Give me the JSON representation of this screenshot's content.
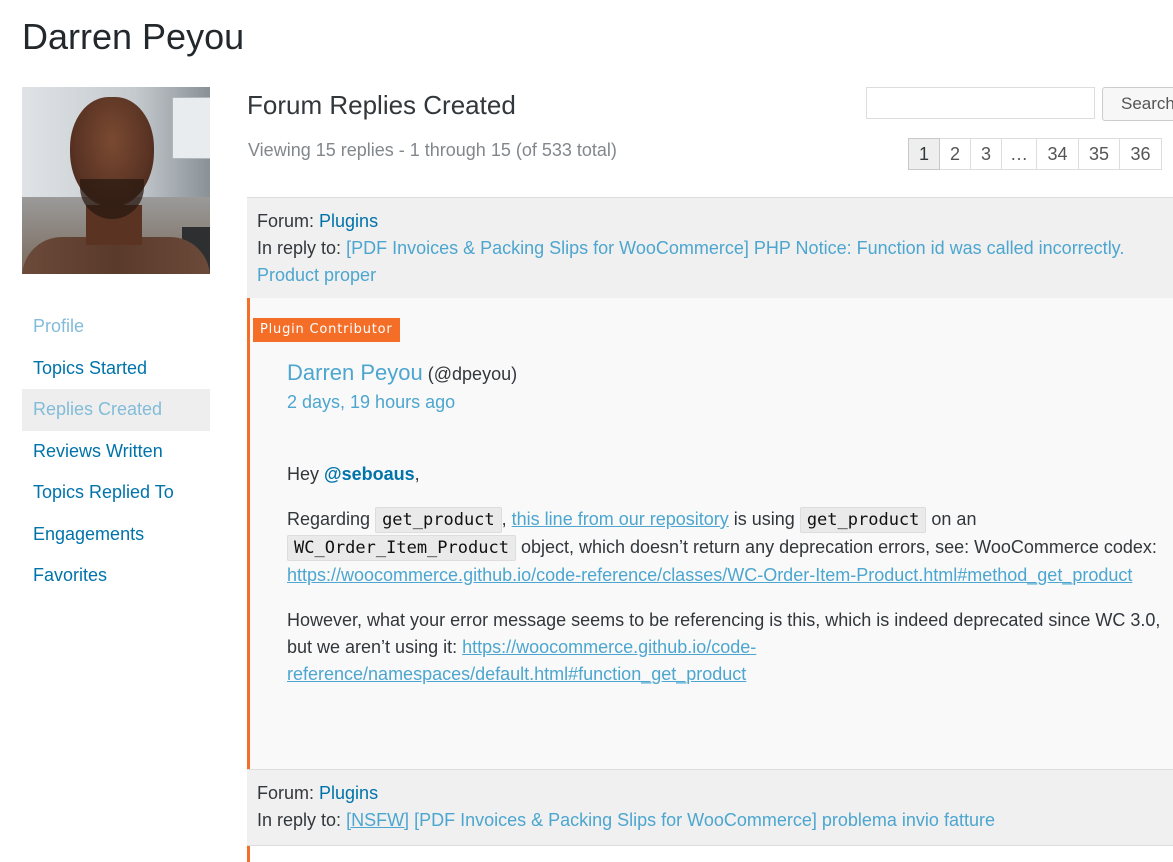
{
  "page": {
    "title": "Darren Peyou"
  },
  "sidebar": {
    "items": [
      {
        "label": "Profile"
      },
      {
        "label": "Topics Started"
      },
      {
        "label": "Replies Created"
      },
      {
        "label": "Reviews Written"
      },
      {
        "label": "Topics Replied To"
      },
      {
        "label": "Engagements"
      },
      {
        "label": "Favorites"
      }
    ],
    "active_item": "Replies Created"
  },
  "main": {
    "title": "Forum Replies Created",
    "count_text": "Viewing 15 replies - 1 through 15 (of 533 total)"
  },
  "search": {
    "value": "",
    "placeholder": "",
    "button_label": "Search"
  },
  "pagination": {
    "current": "1",
    "pages": [
      "1",
      "2",
      "3",
      "…",
      "34",
      "35",
      "36"
    ]
  },
  "replies": [
    {
      "forum_label": "Forum:",
      "forum_name": "Plugins",
      "reply_to_label": "In reply to:",
      "topic_title": "[PDF Invoices & Packing Slips for WooCommerce] PHP Notice: Function id was called incorrectly. Product proper",
      "badge": "Plugin Contributor",
      "author_name": "Darren Peyou",
      "author_handle": "(@dpeyou)",
      "timestamp": "2 days, 19 hours ago",
      "content": {
        "greeting": "Hey ",
        "mention": "@seboaus",
        "greeting_end": ",",
        "p2_t1": "Regarding ",
        "p2_code1": "get_product",
        "p2_t2": ", ",
        "p2_link1": "this line from our repository",
        "p2_t3": " is using ",
        "p2_code2": "get_product",
        "p2_t4": " on an ",
        "p2_code3": "WC_Order_Item_Product",
        "p2_t5": " object, which doesn’t return any deprecation errors, see: WooCommerce codex: ",
        "p2_link2": "https://woocommerce.github.io/code-reference/classes/WC-Order-Item-Product.html#method_get_product",
        "p3_t1": "However, what your error message seems to be referencing is this, which is indeed deprecated since WC 3.0, but we aren’t using it: ",
        "p3_link": "https://woocommerce.github.io/code-reference/namespaces/default.html#function_get_product"
      }
    },
    {
      "forum_label": "Forum:",
      "forum_name": "Plugins",
      "reply_to_label": "In reply to:",
      "nsfw_tag": "[NSFW]",
      "topic_title": "[PDF Invoices & Packing Slips for WooCommerce] problema invio fatture"
    }
  ],
  "colors": {
    "link": "#0073aa",
    "link_light": "#4ca6cf",
    "accent_orange": "#f56e28",
    "header_bg": "#f0f0f0"
  }
}
